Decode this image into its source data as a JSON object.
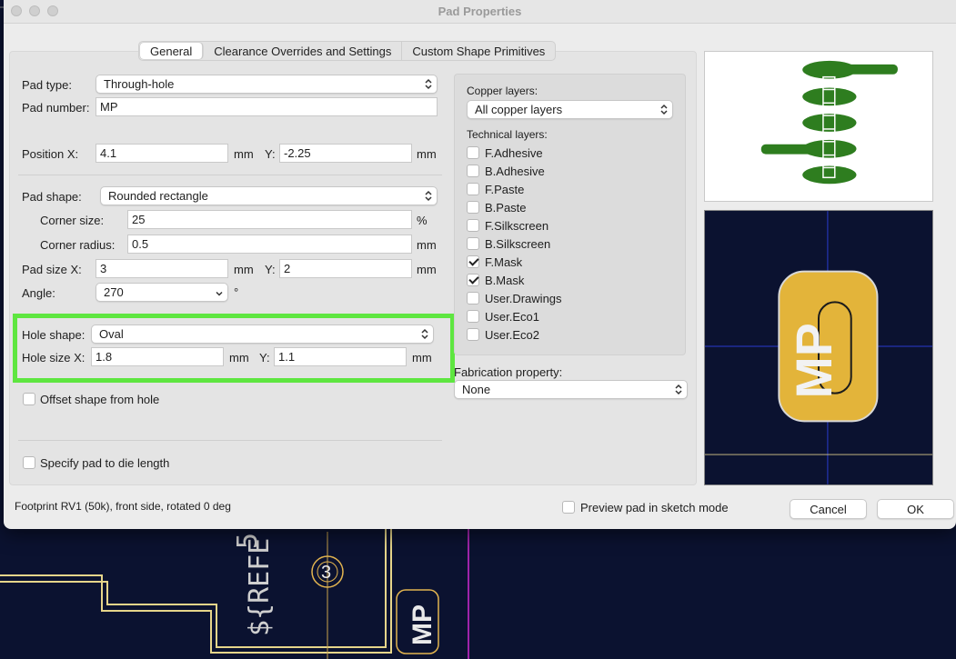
{
  "window": {
    "title": "Pad Properties"
  },
  "tabs": [
    {
      "label": "General",
      "active": true
    },
    {
      "label": "Clearance Overrides and Settings",
      "active": false
    },
    {
      "label": "Custom Shape Primitives",
      "active": false
    }
  ],
  "pad": {
    "type_label": "Pad type:",
    "type_value": "Through-hole",
    "number_label": "Pad number:",
    "number_value": "MP",
    "pos_x_label": "Position X:",
    "pos_x_value": "4.1",
    "pos_y_label": "Y:",
    "pos_y_value": "-2.25",
    "shape_label": "Pad shape:",
    "shape_value": "Rounded rectangle",
    "corner_size_label": "Corner size:",
    "corner_size_value": "25",
    "corner_size_unit": "%",
    "corner_radius_label": "Corner radius:",
    "corner_radius_value": "0.5",
    "size_x_label": "Pad size X:",
    "size_x_value": "3",
    "size_y_label": "Y:",
    "size_y_value": "2",
    "angle_label": "Angle:",
    "angle_value": "270",
    "angle_unit": "°",
    "unit": "mm"
  },
  "hole": {
    "shape_label": "Hole shape:",
    "shape_value": "Oval",
    "size_x_label": "Hole size X:",
    "size_x_value": "1.8",
    "size_y_label": "Y:",
    "size_y_value": "1.1",
    "offset_label": "Offset shape from hole",
    "die_length_label": "Specify pad to die length"
  },
  "layers": {
    "copper_label": "Copper layers:",
    "copper_value": "All copper layers",
    "technical_label": "Technical layers:",
    "items": [
      {
        "label": "F.Adhesive",
        "checked": false
      },
      {
        "label": "B.Adhesive",
        "checked": false
      },
      {
        "label": "F.Paste",
        "checked": false
      },
      {
        "label": "B.Paste",
        "checked": false
      },
      {
        "label": "F.Silkscreen",
        "checked": false
      },
      {
        "label": "B.Silkscreen",
        "checked": false
      },
      {
        "label": "F.Mask",
        "checked": true
      },
      {
        "label": "B.Mask",
        "checked": true
      },
      {
        "label": "User.Drawings",
        "checked": false
      },
      {
        "label": "User.Eco1",
        "checked": false
      },
      {
        "label": "User.Eco2",
        "checked": false
      }
    ],
    "fab_label": "Fabrication property:",
    "fab_value": "None"
  },
  "footer": {
    "status": "Footprint RV1 (50k), front side, rotated 0 deg",
    "sketch_label": "Preview pad in sketch mode",
    "cancel": "Cancel",
    "ok": "OK"
  },
  "preview": {
    "pad_text": "MP"
  },
  "pcb": {
    "text_ref": "${REFE",
    "digit5": "5",
    "pin3": "3",
    "pad_text": "MP"
  },
  "colors": {
    "highlight": "#5ee640",
    "pad_gold": "#e3b43a",
    "board_bg": "#0b1230",
    "copper_green": "#2e7d1f"
  }
}
